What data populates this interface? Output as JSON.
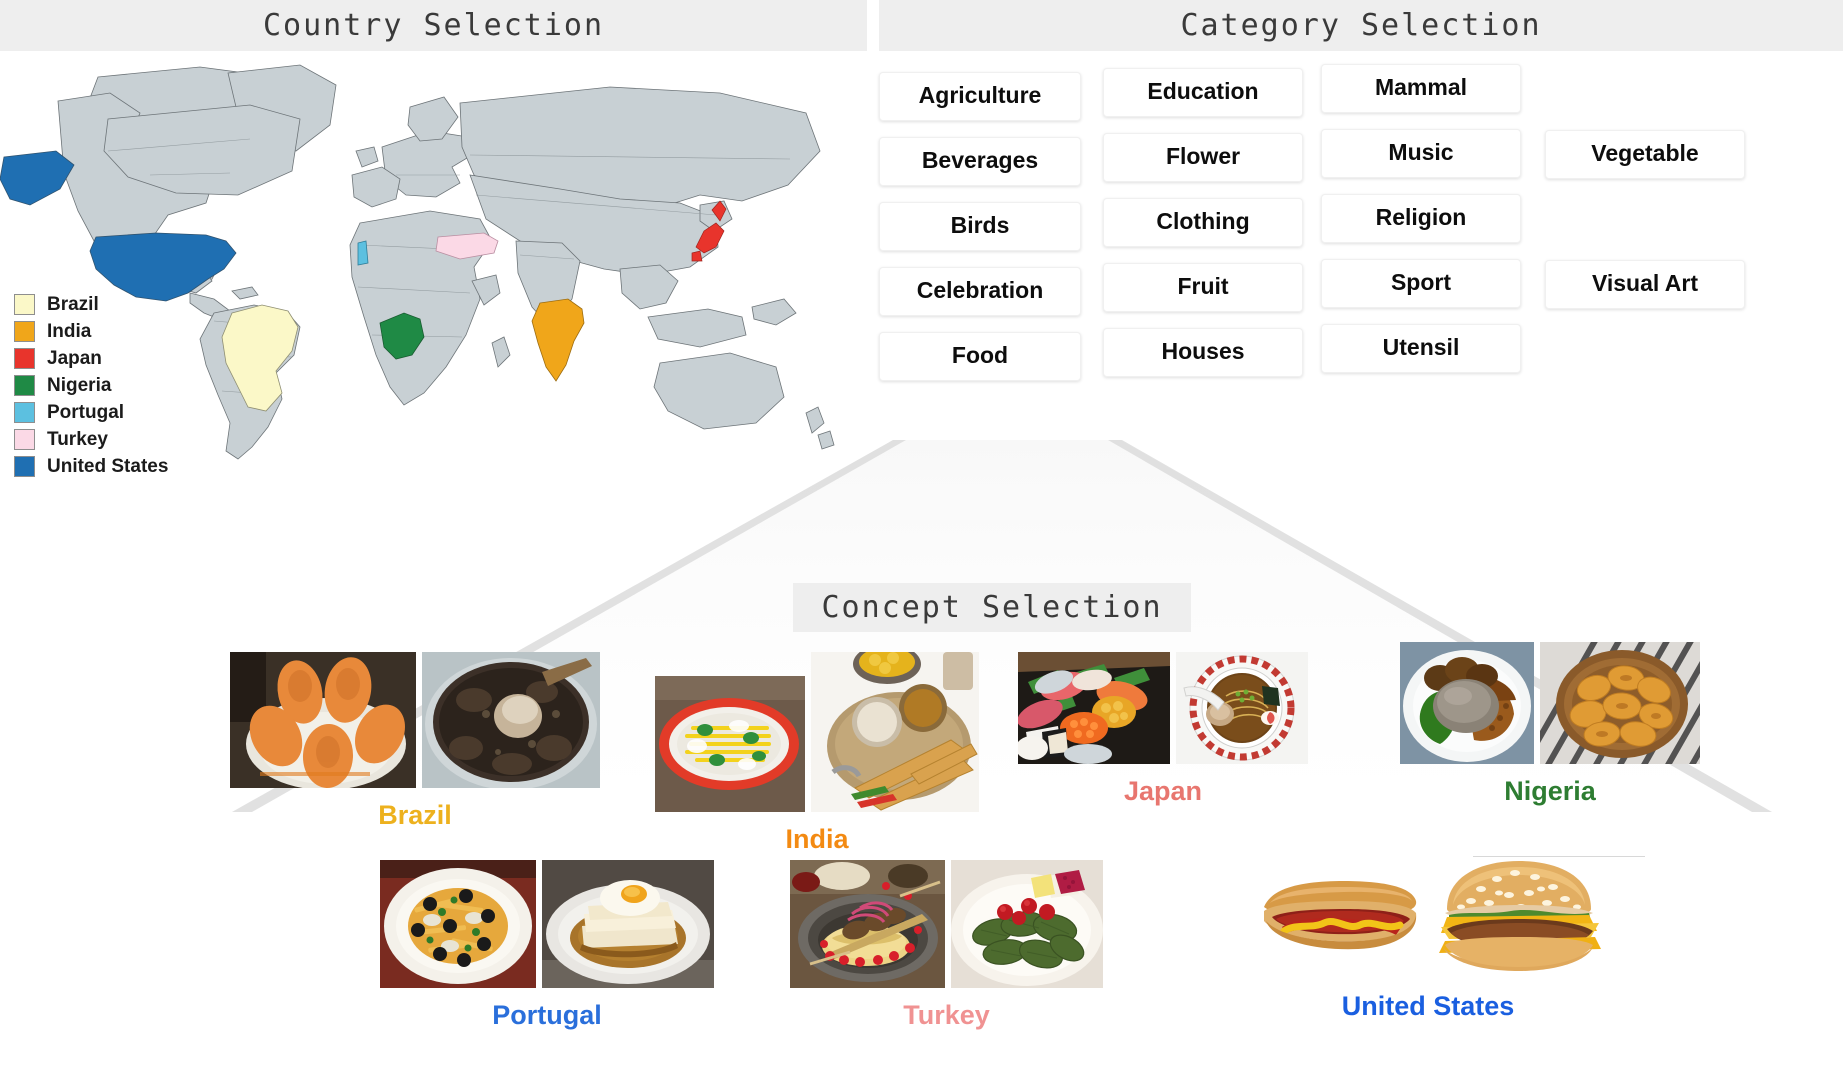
{
  "panels": {
    "country": {
      "title": "Country Selection"
    },
    "category": {
      "title": "Category Selection"
    },
    "concept": {
      "title": "Concept Selection"
    }
  },
  "map": {
    "base_land_color": "#c8d0d4",
    "border_color": "#6d7478",
    "legend": [
      {
        "name": "Brazil",
        "color": "#fbf8c8"
      },
      {
        "name": "India",
        "color": "#f0a61a"
      },
      {
        "name": "Japan",
        "color": "#e8342c"
      },
      {
        "name": "Nigeria",
        "color": "#1f8a45"
      },
      {
        "name": "Portugal",
        "color": "#5cc0e0"
      },
      {
        "name": "Turkey",
        "color": "#fbd9e6"
      },
      {
        "name": "United States",
        "color": "#1f6fb2"
      }
    ]
  },
  "categories": {
    "columns": [
      [
        "Agriculture",
        "Beverages",
        "Birds",
        "Celebration",
        "Food"
      ],
      [
        "Education",
        "Flower",
        "Clothing",
        "Fruit",
        "Houses"
      ],
      [
        "Mammal",
        "Music",
        "Religion",
        "Sport",
        "Utensil"
      ],
      [
        "",
        "Vegetable",
        "",
        "Visual Art",
        ""
      ]
    ],
    "selected": "Food"
  },
  "concepts": {
    "rows": [
      [
        {
          "country": "Brazil",
          "color": "#edb11e",
          "images": [
            {
              "name": "coxinha-fried-snacks",
              "alt": "Plate of coxinha fried snacks"
            },
            {
              "name": "feijoada-black-bean-stew",
              "alt": "Pot of feijoada black bean stew"
            }
          ]
        },
        {
          "country": "India",
          "color": "#f38a12",
          "images": [
            {
              "name": "chaat-dahi-puri",
              "alt": "Chaat in a red bowl with sev and yogurt"
            },
            {
              "name": "dosa-with-chutney-sambar",
              "alt": "Dosa served with chutney and sambar"
            }
          ]
        },
        {
          "country": "Japan",
          "color": "#e8766f",
          "images": [
            {
              "name": "sushi-assortment",
              "alt": "Assorted sushi and sashimi platter"
            },
            {
              "name": "ramen-bowl",
              "alt": "Bowl of shoyu ramen with chashu and nori"
            }
          ]
        },
        {
          "country": "Nigeria",
          "color": "#2e7d32",
          "images": [
            {
              "name": "amala-ewedu-stew",
              "alt": "Amala with ewedu soup and stew"
            },
            {
              "name": "fried-plantain-dodo",
              "alt": "Wooden bowl of fried plantain"
            }
          ]
        }
      ],
      [
        {
          "country": "Portugal",
          "color": "#2a6fdb",
          "images": [
            {
              "name": "bacalhau-a-bras",
              "alt": "Bacalhau a bras with black olives"
            },
            {
              "name": "francesinha-sandwich",
              "alt": "Francesinha with fried egg and sauce"
            }
          ]
        },
        {
          "country": "Turkey",
          "color": "#f09292",
          "images": [
            {
              "name": "kebab-with-flatbread",
              "alt": "Skewered kebab on flatbread with onions"
            },
            {
              "name": "dolma-stuffed-grape-leaves",
              "alt": "Plate of dolma stuffed grape leaves"
            }
          ]
        },
        {
          "country": "United States",
          "color": "#1a5fe0",
          "images": [
            {
              "name": "hot-dog",
              "alt": "Hot dog with ketchup and mustard"
            },
            {
              "name": "cheeseburger",
              "alt": "Sesame seed bun cheeseburger"
            }
          ]
        }
      ]
    ]
  }
}
